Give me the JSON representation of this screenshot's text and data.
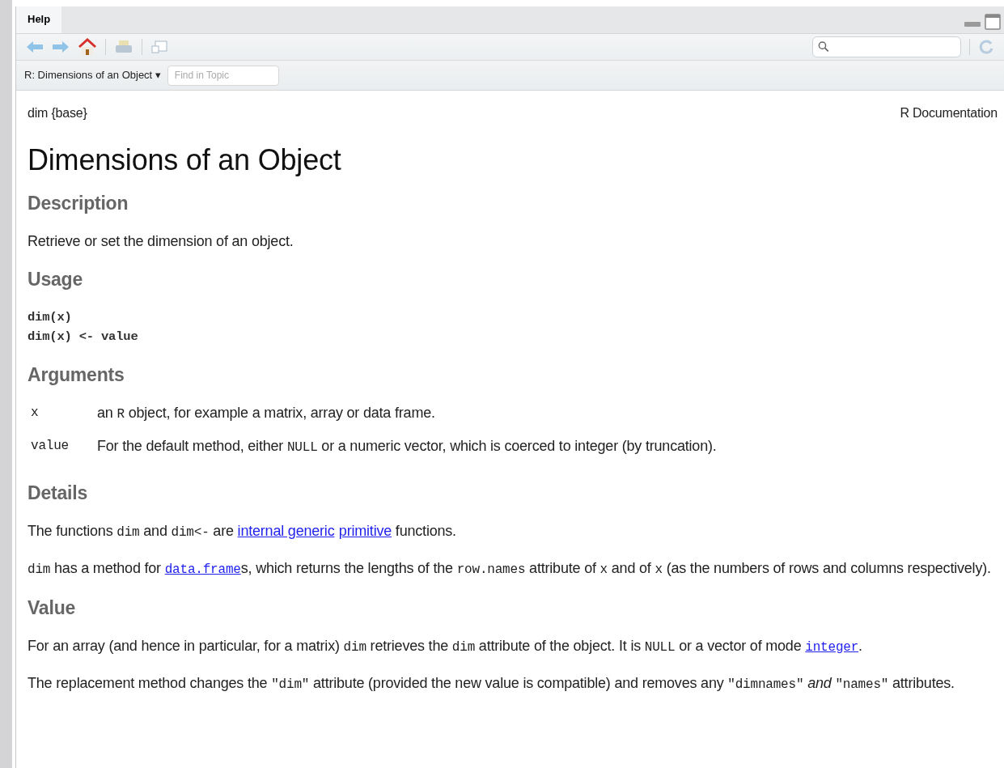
{
  "pane": {
    "tab": {
      "label": "Help"
    }
  },
  "topic_bar": {
    "topic": "R: Dimensions of an Object",
    "caret": "▾",
    "find": {
      "placeholder": "Find in Topic"
    }
  },
  "doc": {
    "package": "dim {base}",
    "source": "R Documentation",
    "title": "Dimensions of an Object",
    "sections": [
      {
        "heading": "Description",
        "blocks": [
          {
            "kind": "para",
            "parts": [
              {
                "kind": "text",
                "text": "Retrieve or set the dimension of an object."
              }
            ]
          }
        ]
      },
      {
        "heading": "Usage",
        "blocks": [
          {
            "kind": "code",
            "lines": [
              "dim(x)",
              "dim(x) <- value"
            ]
          }
        ]
      },
      {
        "heading": "Arguments",
        "blocks": [
          {
            "kind": "args",
            "rows": [
              {
                "name": "x",
                "parts": [
                  {
                    "kind": "text",
                    "text": "an "
                  },
                  {
                    "kind": "code",
                    "text": "R"
                  },
                  {
                    "kind": "text",
                    "text": " object, for example a matrix, array or data frame."
                  }
                ]
              },
              {
                "name": "value",
                "parts": [
                  {
                    "kind": "text",
                    "text": "For the default method, either "
                  },
                  {
                    "kind": "code",
                    "text": "NULL"
                  },
                  {
                    "kind": "text",
                    "text": " or a numeric vector, which is coerced to integer (by truncation)."
                  }
                ]
              }
            ]
          }
        ]
      },
      {
        "heading": "Details",
        "blocks": [
          {
            "kind": "para",
            "parts": [
              {
                "kind": "text",
                "text": "The functions "
              },
              {
                "kind": "code",
                "text": "dim"
              },
              {
                "kind": "text",
                "text": " and "
              },
              {
                "kind": "code",
                "text": "dim<-"
              },
              {
                "kind": "text",
                "text": " are "
              },
              {
                "kind": "link",
                "text": "internal generic"
              },
              {
                "kind": "link",
                "text": "primitive"
              },
              {
                "kind": "text",
                "text": " functions."
              }
            ]
          },
          {
            "kind": "para",
            "parts": [
              {
                "kind": "code",
                "text": "dim"
              },
              {
                "kind": "text",
                "text": " has a method for "
              },
              {
                "kind": "codelink",
                "text": "data.frame"
              },
              {
                "kind": "text",
                "text": "s, which returns the lengths of the "
              },
              {
                "kind": "code",
                "text": "row.names"
              },
              {
                "kind": "text",
                "text": " attribute of "
              },
              {
                "kind": "code",
                "text": "x"
              },
              {
                "kind": "text",
                "text": " and of "
              },
              {
                "kind": "code",
                "text": "x"
              },
              {
                "kind": "text",
                "text": " (as the numbers of rows and columns respectively)."
              }
            ]
          }
        ]
      },
      {
        "heading": "Value",
        "blocks": [
          {
            "kind": "para",
            "parts": [
              {
                "kind": "text",
                "text": "For an array (and hence in particular, for a matrix) "
              },
              {
                "kind": "code",
                "text": "dim"
              },
              {
                "kind": "text",
                "text": " retrieves the "
              },
              {
                "kind": "code",
                "text": "dim"
              },
              {
                "kind": "text",
                "text": " attribute of the object. It is "
              },
              {
                "kind": "code",
                "text": "NULL"
              },
              {
                "kind": "text",
                "text": " or a vector of mode "
              },
              {
                "kind": "codelink",
                "text": "integer"
              },
              {
                "kind": "text",
                "text": "."
              }
            ]
          },
          {
            "kind": "para",
            "parts": [
              {
                "kind": "text",
                "text": "The replacement method changes the "
              },
              {
                "kind": "code",
                "text": "\"dim\""
              },
              {
                "kind": "text",
                "text": " attribute (provided the new value is compatible) and removes any "
              },
              {
                "kind": "code",
                "text": "\"dimnames\""
              },
              {
                "kind": "italic",
                "text": " and "
              },
              {
                "kind": "code",
                "text": "\"names\""
              },
              {
                "kind": "text",
                "text": " attributes."
              }
            ]
          }
        ]
      }
    ]
  }
}
